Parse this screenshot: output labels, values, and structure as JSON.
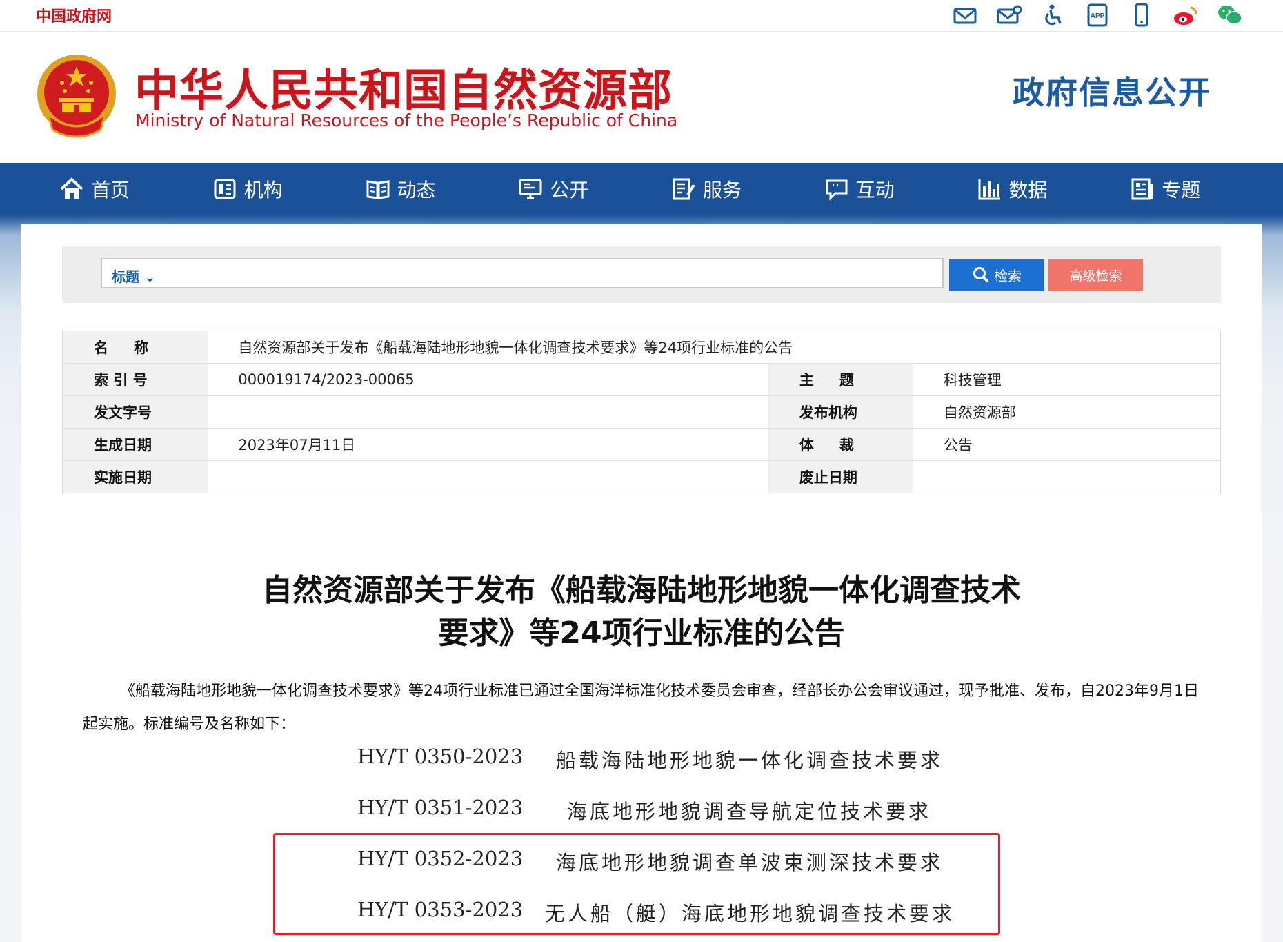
{
  "topbar": {
    "gov_link": "中国政府网",
    "icons": [
      "mail-icon",
      "mail-settings-icon",
      "accessibility-icon",
      "app-icon",
      "mobile-icon",
      "weibo-icon",
      "wechat-icon"
    ]
  },
  "header": {
    "site_name_cn": "中华人民共和国自然资源部",
    "site_name_en": "Ministry of Natural Resources of the People’s Republic of China",
    "section": "政府信息公开"
  },
  "nav": [
    {
      "label": "首页",
      "icon": "home-icon"
    },
    {
      "label": "机构",
      "icon": "org-icon"
    },
    {
      "label": "动态",
      "icon": "book-icon"
    },
    {
      "label": "公开",
      "icon": "monitor-icon"
    },
    {
      "label": "服务",
      "icon": "edit-icon"
    },
    {
      "label": "互动",
      "icon": "chat-icon"
    },
    {
      "label": "数据",
      "icon": "chart-icon"
    },
    {
      "label": "专题",
      "icon": "topic-icon"
    }
  ],
  "search": {
    "scope": "标题",
    "value": "",
    "search_label": "检索",
    "advanced_label": "高级检索"
  },
  "meta": {
    "name_label": "名　称",
    "name_value": "自然资源部关于发布《船载海陆地形地貌一体化调查技术要求》等24项行业标准的公告",
    "index_label": "索 引 号",
    "index_value": "000019174/2023-00065",
    "subject_label": "主　题",
    "subject_value": "科技管理",
    "doc_no_label": "发文字号",
    "doc_no_value": "",
    "publisher_label": "发布机构",
    "publisher_value": "自然资源部",
    "date_label": "生成日期",
    "date_value": "2023年07月11日",
    "genre_label": "体　裁",
    "genre_value": "公告",
    "effective_label": "实施日期",
    "effective_value": "",
    "repeal_label": "废止日期",
    "repeal_value": ""
  },
  "article": {
    "title_line1": "自然资源部关于发布《船载海陆地形地貌一体化调查技术",
    "title_line2": "要求》等24项行业标准的公告",
    "intro": "《船载海陆地形地貌一体化调查技术要求》等24项行业标准已通过全国海洋标准化技术委员会审查，经部长办公会审议通过，现予批准、发布，自2023年9月1日起实施。标准编号及名称如下：",
    "standards": [
      {
        "code": "HY/T 0350-2023",
        "name": "船载海陆地形地貌一体化调查技术要求"
      },
      {
        "code": "HY/T 0351-2023",
        "name": "海底地形地貌调查导航定位技术要求"
      },
      {
        "code": "HY/T 0352-2023",
        "name": "海底地形地貌调查单波束测深技术要求"
      },
      {
        "code": "HY/T 0353-2023",
        "name": "无人船（艇）海底地形地貌调查技术要求"
      }
    ],
    "highlight_color": "#e0202a"
  }
}
